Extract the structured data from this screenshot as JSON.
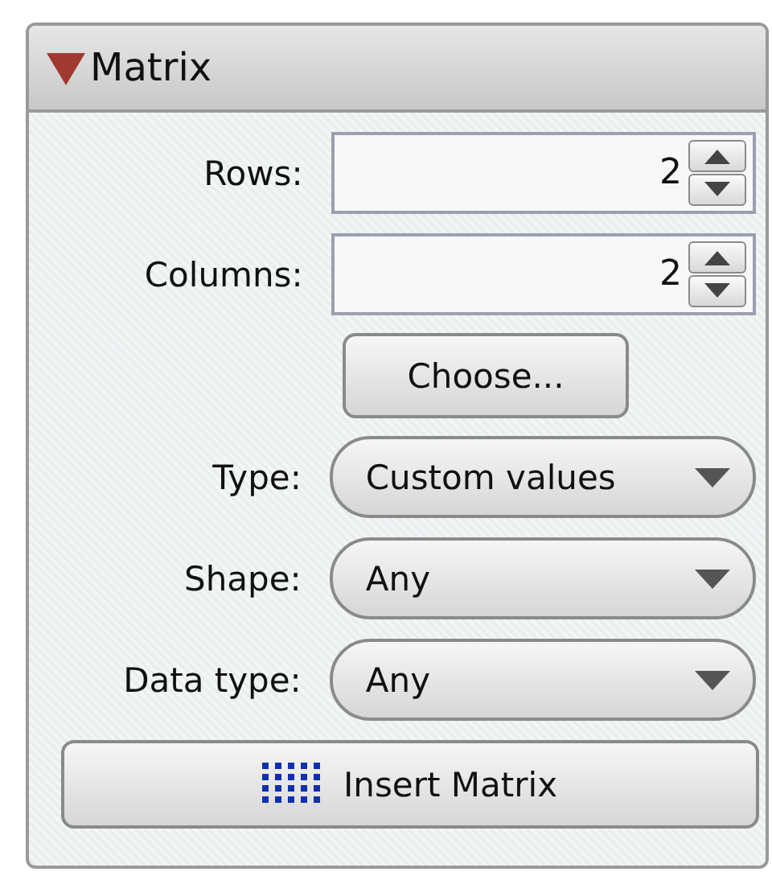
{
  "panel": {
    "title": "Matrix",
    "expanded": true
  },
  "spin_fields": [
    {
      "label": "Rows:",
      "value": "2"
    },
    {
      "label": "Columns:",
      "value": "2"
    }
  ],
  "choose_button": "Choose...",
  "dropdowns": [
    {
      "label": "Type:",
      "value": "Custom values"
    },
    {
      "label": "Shape:",
      "value": "Any"
    },
    {
      "label": "Data type:",
      "value": "Any"
    }
  ],
  "insert_button": "Insert Matrix"
}
